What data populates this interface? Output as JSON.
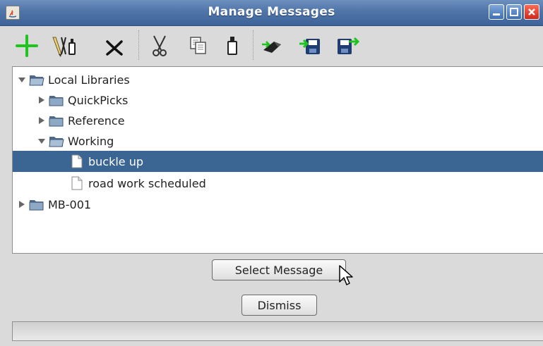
{
  "window": {
    "title": "Manage Messages"
  },
  "toolbar": {
    "buttons": [
      {
        "name": "add",
        "icon": "plus-icon",
        "color": "#1fc41f"
      },
      {
        "name": "edit",
        "icon": "pencil-icon"
      },
      {
        "name": "delete",
        "icon": "delete-x-icon"
      },
      {
        "name": "cut",
        "icon": "scissors-icon"
      },
      {
        "name": "copy",
        "icon": "copy-icon"
      },
      {
        "name": "paste",
        "icon": "paste-icon"
      },
      {
        "name": "send",
        "icon": "send-icon"
      },
      {
        "name": "import",
        "icon": "import-icon"
      },
      {
        "name": "export",
        "icon": "export-icon"
      }
    ]
  },
  "tree": {
    "nodes": [
      {
        "label": "Local Libraries",
        "type": "folder",
        "expanded": true,
        "depth": 0
      },
      {
        "label": "QuickPicks",
        "type": "folder",
        "expanded": false,
        "depth": 1
      },
      {
        "label": "Reference",
        "type": "folder",
        "expanded": false,
        "depth": 1
      },
      {
        "label": "Working",
        "type": "folder",
        "expanded": true,
        "depth": 1
      },
      {
        "label": "buckle up",
        "type": "message",
        "selected": true,
        "depth": 2
      },
      {
        "label": "road work scheduled",
        "type": "message",
        "selected": false,
        "depth": 2
      },
      {
        "label": "MB-001",
        "type": "folder",
        "expanded": false,
        "depth": 0
      }
    ],
    "selection_color": "#3b6593"
  },
  "buttons": {
    "select_label": "Select Message",
    "dismiss_label": "Dismiss"
  },
  "colors": {
    "titlebar": "#4f74a8",
    "close": "#d0261a"
  }
}
